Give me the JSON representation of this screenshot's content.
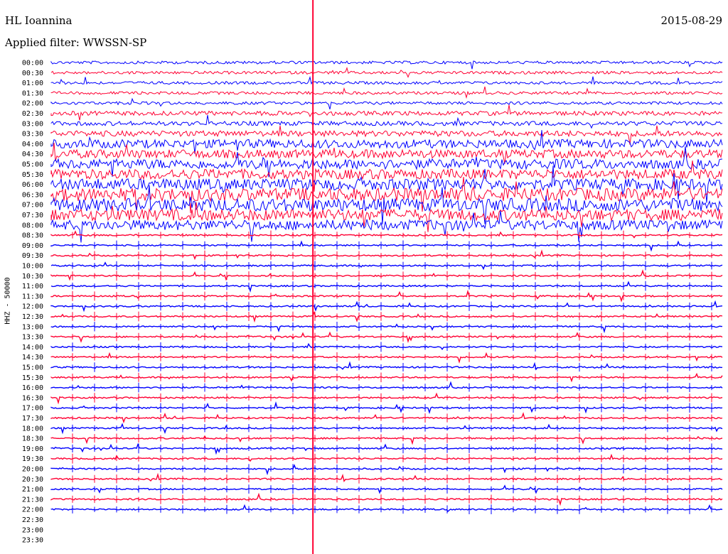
{
  "header": {
    "station": "HL Ioannina",
    "filter": "Applied filter: WWSSN-SP",
    "date": "2015-08-29"
  },
  "chart_data": {
    "type": "line",
    "ylabel": "HHZ - 50000",
    "rows": [
      "00:00",
      "00:30",
      "01:00",
      "01:30",
      "02:00",
      "02:30",
      "03:00",
      "03:30",
      "04:00",
      "04:30",
      "05:00",
      "05:30",
      "06:00",
      "06:30",
      "07:00",
      "07:30",
      "08:00",
      "08:30",
      "09:00",
      "09:30",
      "10:00",
      "10:30",
      "11:00",
      "11:30",
      "12:00",
      "12:30",
      "13:00",
      "13:30",
      "14:00",
      "14:30",
      "15:00",
      "15:30",
      "16:00",
      "16:30",
      "17:00",
      "17:30",
      "18:00",
      "18:30",
      "19:00",
      "19:30",
      "20:00",
      "20:30",
      "21:00",
      "21:30",
      "22:00",
      "22:30",
      "23:00",
      "23:30"
    ],
    "series_colors": [
      "#0000ff",
      "#ff0033"
    ],
    "noise_amplitude": [
      2,
      2,
      2,
      2,
      2,
      3,
      3,
      4,
      6,
      6,
      7,
      7,
      8,
      9,
      9,
      8,
      7,
      1,
      1,
      1,
      1,
      1,
      1,
      1,
      1,
      1,
      1,
      1,
      1,
      1,
      1,
      1,
      1,
      1,
      1,
      1,
      1,
      1,
      1,
      1,
      1,
      1,
      1,
      1,
      1,
      0,
      0,
      0
    ],
    "marker_color": "#ff0033",
    "marker_position_fraction": 0.39
  }
}
